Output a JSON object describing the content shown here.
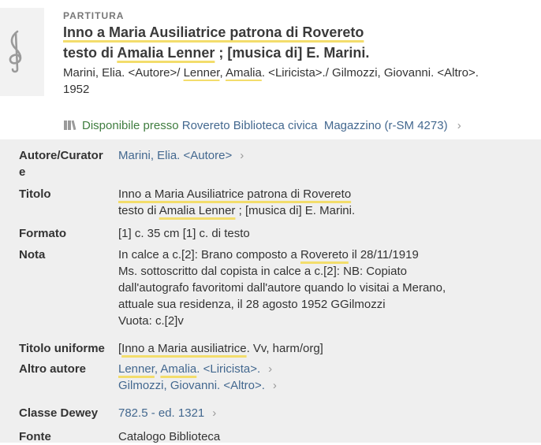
{
  "record": {
    "type": "PARTITURA",
    "title_line1": "Inno a Maria Ausiliatrice patrona di Rovereto",
    "title_line2_a": "testo di ",
    "title_line2_b": "Amalia Lenner",
    "title_line2_c": " ; [musica di] E. Marini.",
    "authors_a": "Marini, Elia. <Autore>/ ",
    "authors_b": "Lenner",
    "authors_c": ", ",
    "authors_d": "Amalia",
    "authors_e": ". <Liricista>./ Gilmozzi, Giovanni. <Altro>.",
    "year": "1952"
  },
  "availability": {
    "status": "Disponibile presso",
    "library": "Rovereto Biblioteca civica",
    "location": "Magazzino (r-SM 4273)",
    "icon": "book-icon"
  },
  "details": {
    "author_label_1": "Autore/Curator",
    "author_label_2": "e",
    "author_value": "Marini, Elia. <Autore>",
    "title_label": "Titolo",
    "title_value1": "Inno a Maria Ausiliatrice patrona di Rovereto",
    "title_value2_a": "testo di ",
    "title_value2_b": "Amalia Lenner",
    "title_value2_c": " ; [musica di] E. Marini.",
    "format_label": "Formato",
    "format_value": "[1] c. 35 cm [1] c. di testo",
    "note_label": "Nota",
    "note_line1_a": "In calce a c.[2]: Brano composto a ",
    "note_line1_b": "Rovereto",
    "note_line1_c": " il 28/11/1919",
    "note_line2": "Ms. sottoscritto dal copista in calce a c.[2]: NB: Copiato",
    "note_line3": "dall'autografo favoritomi dall'autore quando lo visitai a Merano,",
    "note_line4": "attuale sua residenza, il 28 agosto 1952 GGilmozzi",
    "note_line5": "Vuota: c.[2]v",
    "uniform_label": "Titolo uniforme",
    "uniform_value_a": "[",
    "uniform_value_b": "Inno a Maria ausiliatrice",
    "uniform_value_c": ". Vv, harm/org]",
    "other_label": "Altro autore",
    "other1_a": "Lenner",
    "other1_b": ", ",
    "other1_c": "Amalia",
    "other1_d": ". <Liricista>.",
    "other2": "Gilmozzi, Giovanni. <Altro>.",
    "dewey_label": "Classe Dewey",
    "dewey_value": "782.5 - ed. 1321",
    "source_label": "Fonte",
    "source_value": "Catalogo Biblioteca"
  },
  "chevron": "›"
}
